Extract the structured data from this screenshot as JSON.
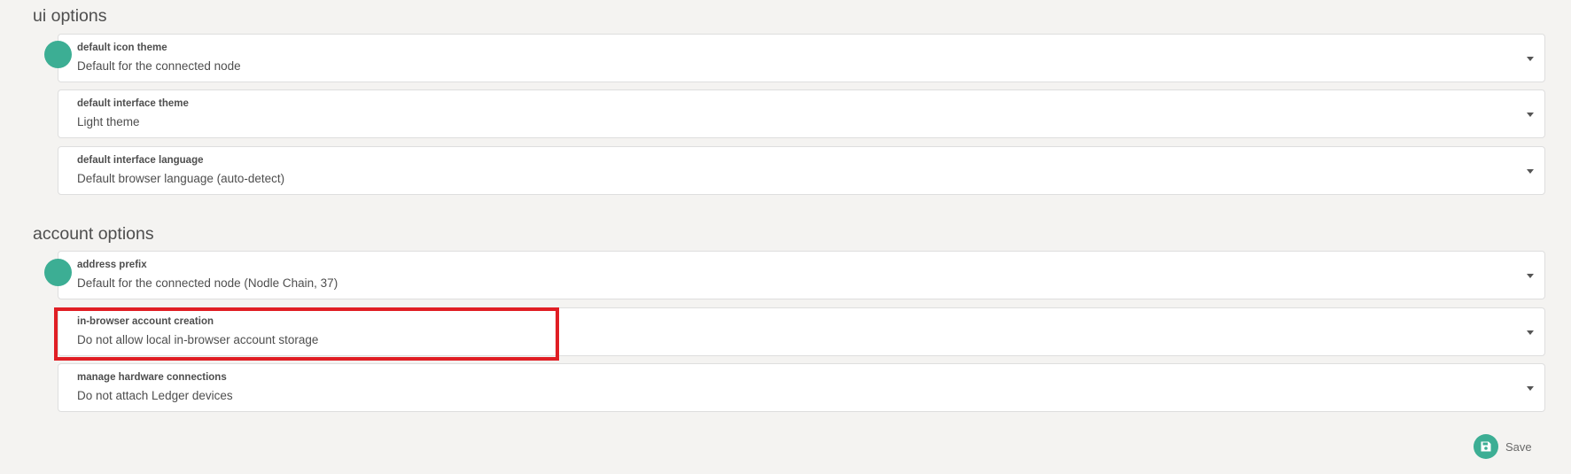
{
  "ui_options": {
    "title": "ui options",
    "fields": [
      {
        "label": "default icon theme",
        "value": "Default for the connected node"
      },
      {
        "label": "default interface theme",
        "value": "Light theme"
      },
      {
        "label": "default interface language",
        "value": "Default browser language (auto-detect)"
      }
    ]
  },
  "account_options": {
    "title": "account options",
    "fields": [
      {
        "label": "address prefix",
        "value": "Default for the connected node (Nodle Chain, 37)"
      },
      {
        "label": "in-browser account creation",
        "value": "Do not allow local in-browser account storage"
      },
      {
        "label": "manage hardware connections",
        "value": "Do not attach Ledger devices"
      }
    ]
  },
  "actions": {
    "save_label": "Save"
  },
  "colors": {
    "accent": "#3cae94",
    "highlight": "#e01e24",
    "background": "#f4f3f1"
  },
  "icons": {
    "save": "save-icon",
    "dropdown": "chevron-down-icon"
  }
}
